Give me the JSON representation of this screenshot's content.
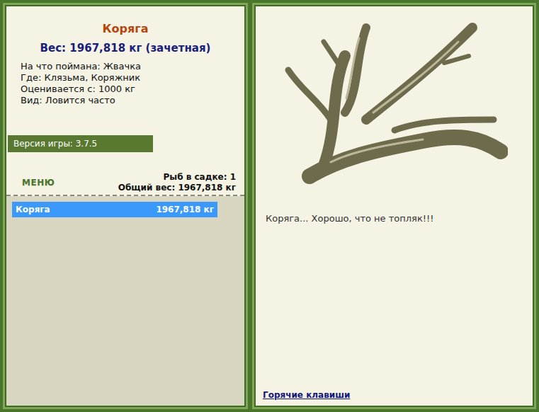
{
  "fish": {
    "name": "Коряга",
    "weight": "Вес: 1967,818 кг (зачетная)",
    "details": [
      "На что поймана: Жвачка",
      "Где: Клязьма, Коряжник",
      "Оценивается с: 1000 кг",
      "Вид: Ловится часто"
    ],
    "description": "Коряга... Хорошо, что не топляк!!!"
  },
  "version": "Версия игры: 3.7.5",
  "menu": "МЕНЮ",
  "keepnet": {
    "count": "Рыб в садке: 1",
    "total": "Общий вес: 1967,818 кг",
    "items": [
      {
        "name": "Коряга",
        "weight": "1967,818 кг",
        "selected": true
      }
    ]
  },
  "hotkeys": "Горячие клавиши"
}
